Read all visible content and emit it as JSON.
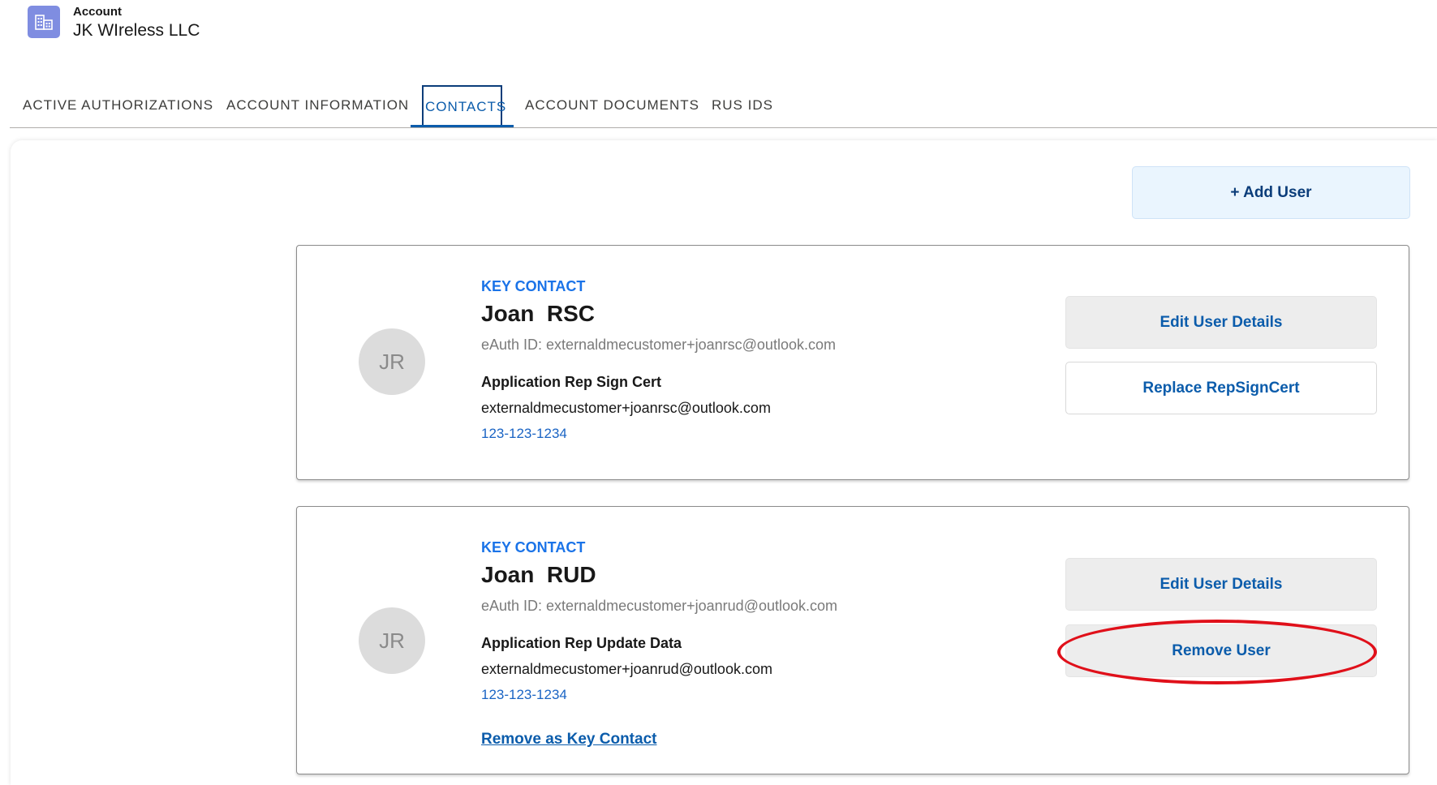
{
  "header": {
    "object_type": "Account",
    "account_name": "JK WIreless LLC",
    "icon": "building-icon",
    "icon_color": "#7f8de1"
  },
  "tabs": [
    {
      "label": "ACTIVE AUTHORIZATIONS",
      "active": false
    },
    {
      "label": "ACCOUNT INFORMATION",
      "active": false
    },
    {
      "label": "CONTACTS",
      "active": true
    },
    {
      "label": "ACCOUNT DOCUMENTS",
      "active": false
    },
    {
      "label": "RUS IDS",
      "active": false
    }
  ],
  "actions": {
    "add_user_label": "+ Add User"
  },
  "contacts": [
    {
      "initials": "JR",
      "badge": "KEY CONTACT",
      "name": "Joan  RSC",
      "eauth": "eAuth ID: externaldmecustomer+joanrsc@outlook.com",
      "role": "Application Rep Sign Cert",
      "email": "externaldmecustomer+joanrsc@outlook.com",
      "phone": "123-123-1234",
      "buttons": {
        "primary": "Edit User Details",
        "secondary": "Replace RepSignCert"
      }
    },
    {
      "initials": "JR",
      "badge": "KEY CONTACT",
      "name": "Joan  RUD",
      "eauth": "eAuth ID: externaldmecustomer+joanrud@outlook.com",
      "role": "Application Rep Update Data",
      "email": "externaldmecustomer+joanrud@outlook.com",
      "phone": "123-123-1234",
      "remove_key_contact": "Remove as Key Contact",
      "buttons": {
        "primary": "Edit User Details",
        "secondary": "Remove User"
      }
    }
  ],
  "colors": {
    "accent_blue": "#0b5cab",
    "key_contact_blue": "#1a73e8",
    "highlight_red": "#e0101a"
  }
}
